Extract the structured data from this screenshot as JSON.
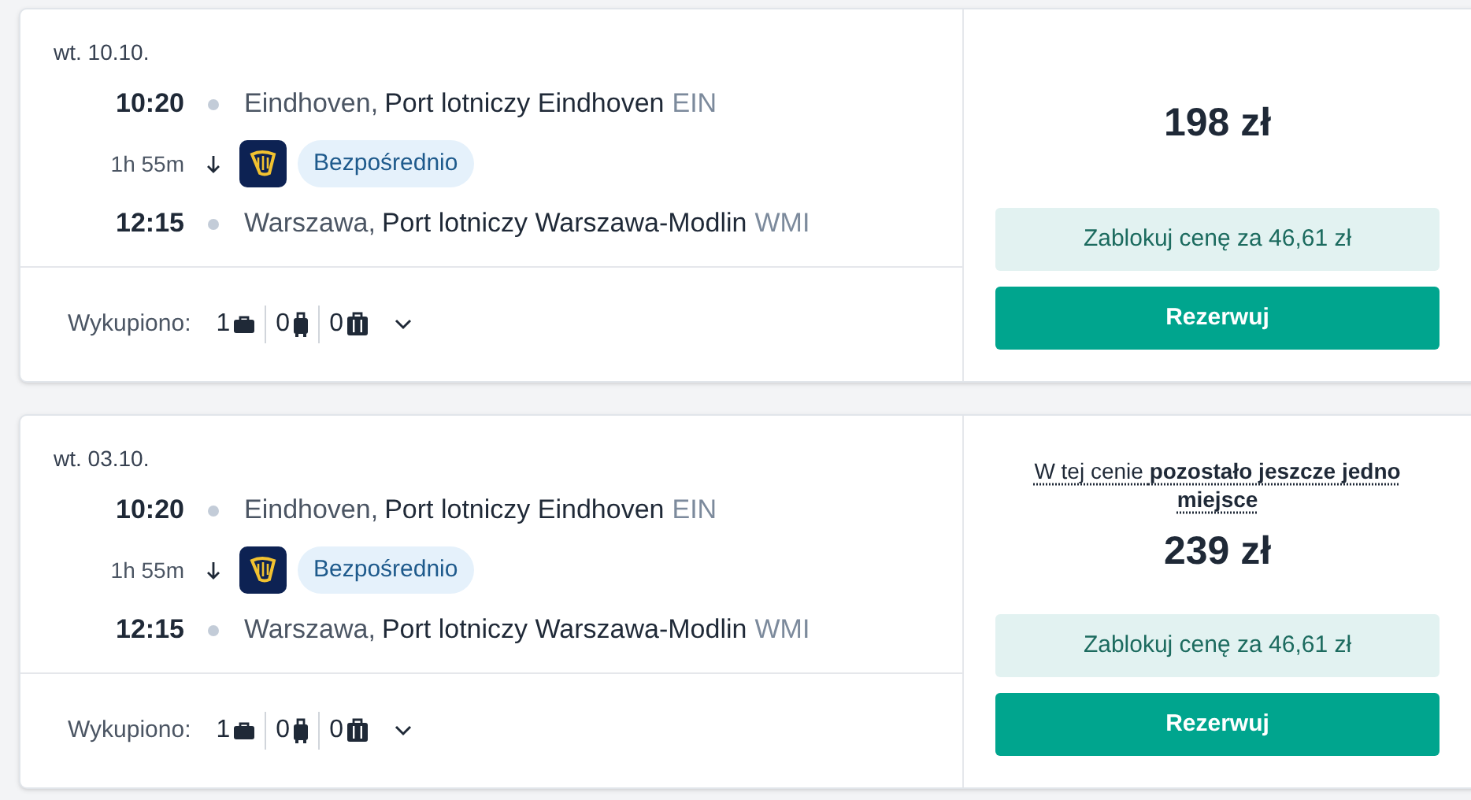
{
  "results": [
    {
      "date": "wt. 10.10.",
      "departure": {
        "time": "10:20",
        "city": "Eindhoven,",
        "airport": "Port lotniczy Eindhoven",
        "code": "EIN"
      },
      "duration": "1h 55m",
      "stop_badge": "Bezpośrednio",
      "arrival": {
        "time": "12:15",
        "city": "Warszawa,",
        "airport": "Port lotniczy Warszawa-Modlin",
        "code": "WMI"
      },
      "baggage_label": "Wykupiono:",
      "baggage": [
        {
          "kind": "personal",
          "count": "1"
        },
        {
          "kind": "cabin",
          "count": "0"
        },
        {
          "kind": "checked",
          "count": "0"
        }
      ],
      "price": "198 zł",
      "lock_button": "Zablokuj cenę za 46,61 zł",
      "book_button": "Rezerwuj"
    },
    {
      "date": "wt. 03.10.",
      "departure": {
        "time": "10:20",
        "city": "Eindhoven,",
        "airport": "Port lotniczy Eindhoven",
        "code": "EIN"
      },
      "duration": "1h 55m",
      "stop_badge": "Bezpośrednio",
      "arrival": {
        "time": "12:15",
        "city": "Warszawa,",
        "airport": "Port lotniczy Warszawa-Modlin",
        "code": "WMI"
      },
      "baggage_label": "Wykupiono:",
      "baggage": [
        {
          "kind": "personal",
          "count": "1"
        },
        {
          "kind": "cabin",
          "count": "0"
        },
        {
          "kind": "checked",
          "count": "0"
        }
      ],
      "notice": "W tej cenie **pozostało jeszcze jedno miejsce**",
      "price": "239 zł",
      "lock_button": "Zablokuj cenę za 46,61 zł",
      "book_button": "Rezerwuj"
    }
  ]
}
